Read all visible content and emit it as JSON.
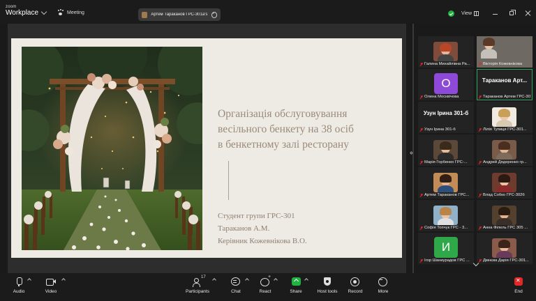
{
  "titlebar": {
    "brand_top": "zoom",
    "brand_bottom": "Workplace",
    "meeting_label": "Meeting",
    "share_pill": "Артем Тараканов ГРС-301а's sc",
    "view_label": "View"
  },
  "slide": {
    "title_line1": "Організація обслуговування",
    "title_line2": "весільного бенкету на 38 осіб",
    "title_line3": "в бенкетному залі ресторану",
    "info_line1": "Студент групи ГРС-301",
    "info_line2": "Тараканов А.М.",
    "info_line3": "Керівник Кожевнікова В.О."
  },
  "gallery": [
    {
      "name": "Галина Михайлівна Ра...",
      "kind": "video"
    },
    {
      "name": "Вікторія Кожевнікова",
      "kind": "video"
    },
    {
      "name": "Олена Москвічова",
      "kind": "letter",
      "letter": "О",
      "color": "#8e49d8"
    },
    {
      "name": "Тараканов Артем ГРС-301...",
      "kind": "bigname",
      "big": "Тараканов  Арт...",
      "active": true
    },
    {
      "name": "Узун Ірина 301-б",
      "kind": "bigname",
      "big": "Узун Ірина 301-б"
    },
    {
      "name": "Лілія Тупиця ГРС-301...",
      "kind": "video"
    },
    {
      "name": "Марія Горбенко ГРС-...",
      "kind": "video"
    },
    {
      "name": "Андрей Дядеренко гр...",
      "kind": "video"
    },
    {
      "name": "Артем Тараканов ГРС...",
      "kind": "video"
    },
    {
      "name": "Влад Собко ГРС-302б",
      "kind": "video"
    },
    {
      "name": "Софія Топчук ГРС - 3...",
      "kind": "video"
    },
    {
      "name": "Анна Філель ГРС 305 ...",
      "kind": "video"
    },
    {
      "name": "Ігор Шаниурадов ГРС ...",
      "kind": "letter",
      "letter": "И",
      "color": "#2ea848"
    },
    {
      "name": "Дмнєва Дарія ГРС-301...",
      "kind": "video"
    }
  ],
  "toolbar": {
    "audio": "Audio",
    "video": "Video",
    "participants": "Participants",
    "participants_count": "17",
    "chat": "Chat",
    "react": "React",
    "share": "Share",
    "host_tools": "Host tools",
    "record": "Record",
    "more": "More",
    "end": "End"
  },
  "colors": {
    "accent_green": "#1fb141",
    "end_red": "#e02828",
    "slide_bg": "#eeebe5",
    "slide_text": "#9a8a7a"
  }
}
